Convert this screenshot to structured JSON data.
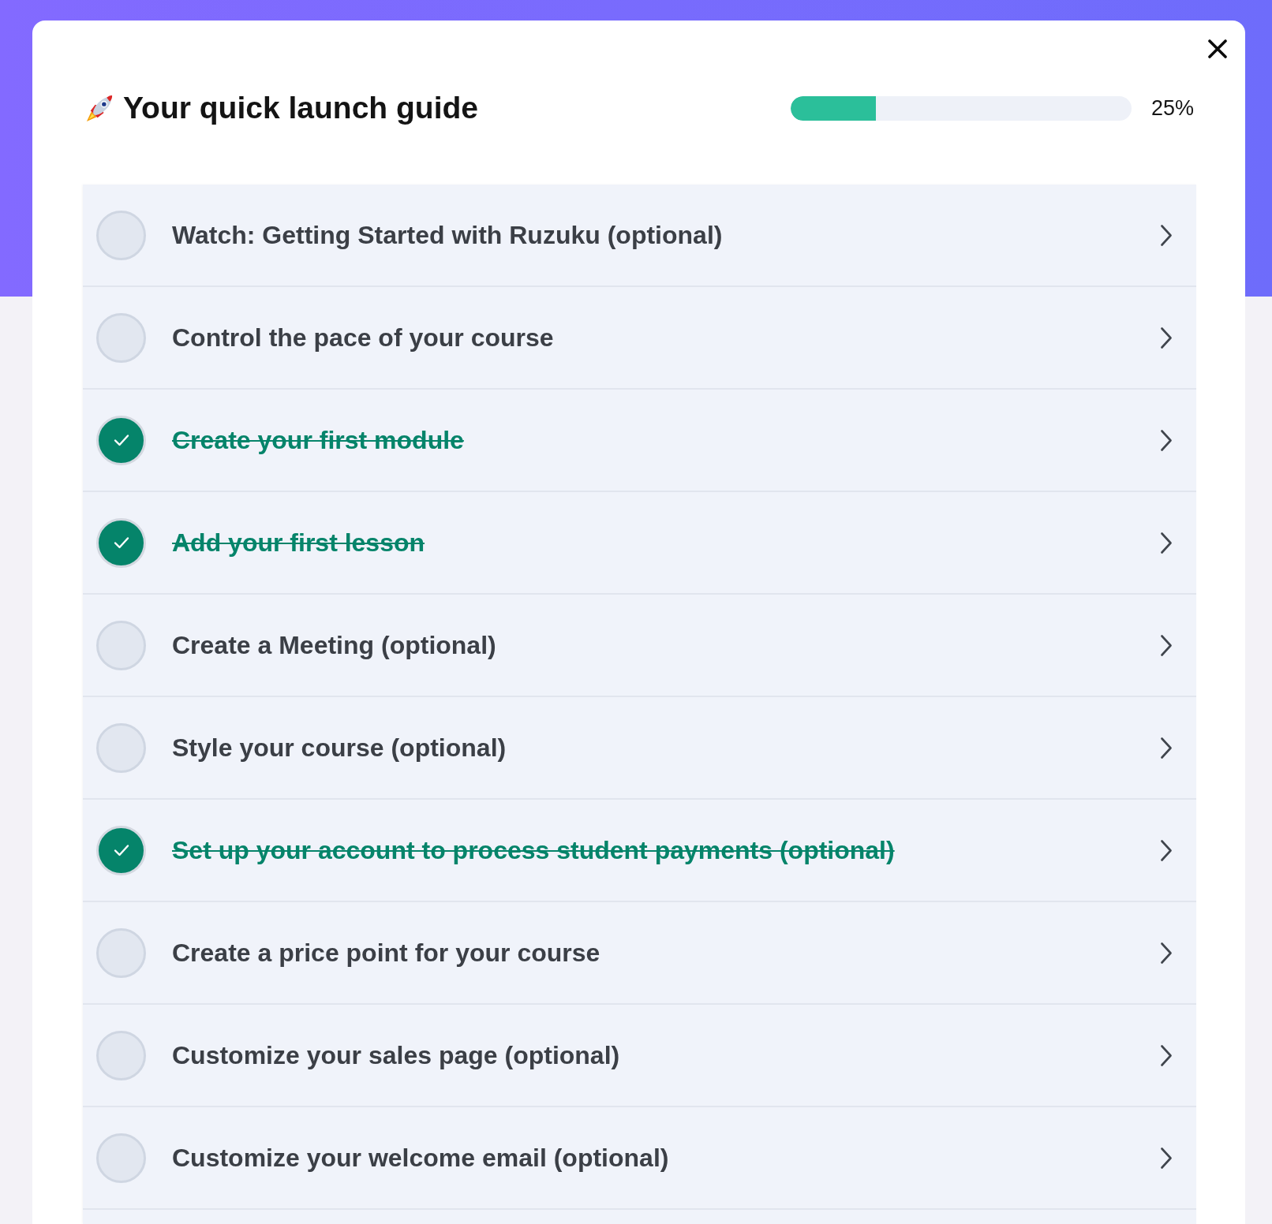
{
  "title": {
    "text": "Your quick launch guide"
  },
  "progress": {
    "level": 0.25,
    "label": "25%"
  },
  "items": [
    {
      "label": "Watch: Getting Started with Ruzuku (optional)",
      "checked": false
    },
    {
      "label": "Control the pace of your course",
      "checked": false
    },
    {
      "label": "Create your first module",
      "checked": true
    },
    {
      "label": "Add your first lesson",
      "checked": true
    },
    {
      "label": "Create a Meeting (optional)",
      "checked": false
    },
    {
      "label": "Style your course (optional)",
      "checked": false
    },
    {
      "label": "Set up your account to process student payments (optional)",
      "checked": true
    },
    {
      "label": "Create a price point for your course",
      "checked": false
    },
    {
      "label": "Customize your sales page (optional)",
      "checked": false
    },
    {
      "label": "Customize your welcome email (optional)",
      "checked": false
    }
  ]
}
